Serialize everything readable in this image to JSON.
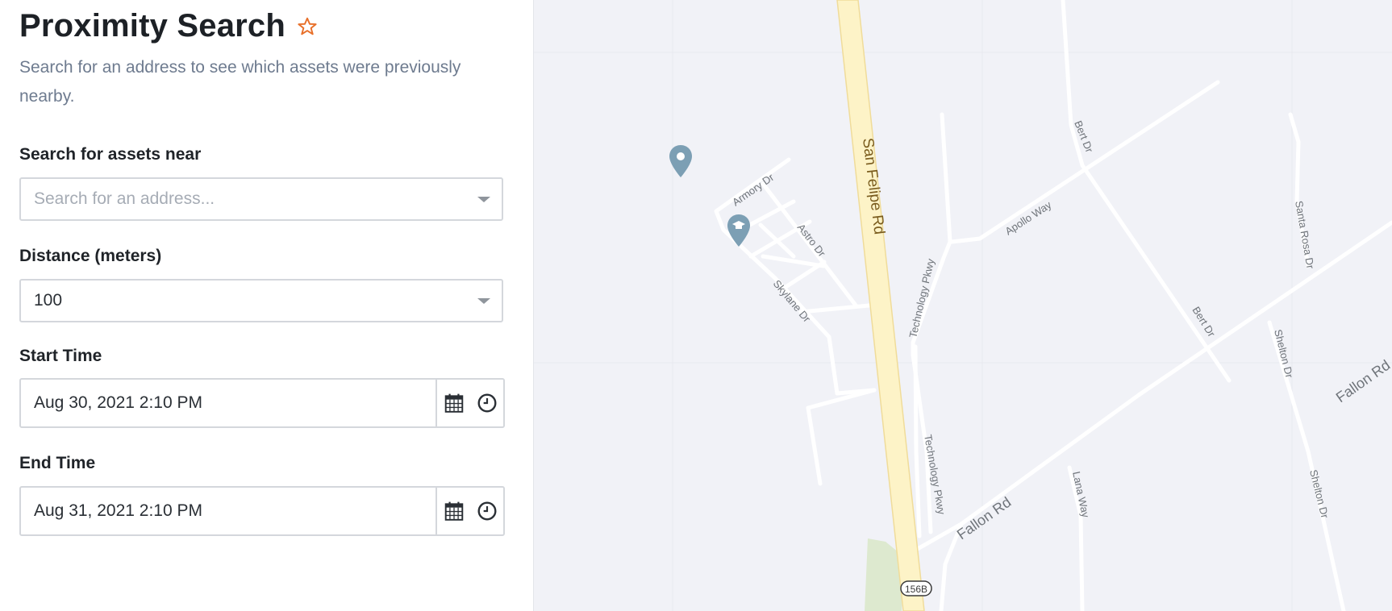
{
  "panel": {
    "title": "Proximity Search",
    "subtitle": "Search for an address to see which assets were previously nearby.",
    "search": {
      "label": "Search for assets near",
      "placeholder": "Search for an address..."
    },
    "distance": {
      "label": "Distance (meters)",
      "value": "100"
    },
    "start_time": {
      "label": "Start Time",
      "value": "Aug 30, 2021 2:10 PM"
    },
    "end_time": {
      "label": "End Time",
      "value": "Aug 31, 2021 2:10 PM"
    }
  },
  "map": {
    "labels": {
      "san_felipe": "San Felipe Rd",
      "armory": "Armory Dr",
      "astro": "Astro Dr",
      "skylane": "Skylane Dr",
      "technology_upper": "Technology Pkwy",
      "technology_lower": "Technology Pkwy",
      "apollo": "Apollo Way",
      "bert_upper": "Bert Dr",
      "bert_lower": "Bert Dr",
      "fallon_upper": "Fallon Rd",
      "fallon_lower": "Fallon Rd",
      "lana": "Lana Way",
      "santa_rosa": "Santa Rosa Dr",
      "shelton_upper": "Shelton Dr",
      "shelton_lower": "Shelton Dr",
      "shield": "156B"
    },
    "colors": {
      "background": "#f1f2f7",
      "highway": "#fdf3c7",
      "highway_edge": "#f0dc9a",
      "road": "#ffffff",
      "park": "#dde9cf",
      "pin": "#7c9fb4"
    }
  },
  "colors": {
    "accent_star": "#e8702a",
    "subtitle": "#6e7b8f",
    "border": "#d4d7dc"
  }
}
